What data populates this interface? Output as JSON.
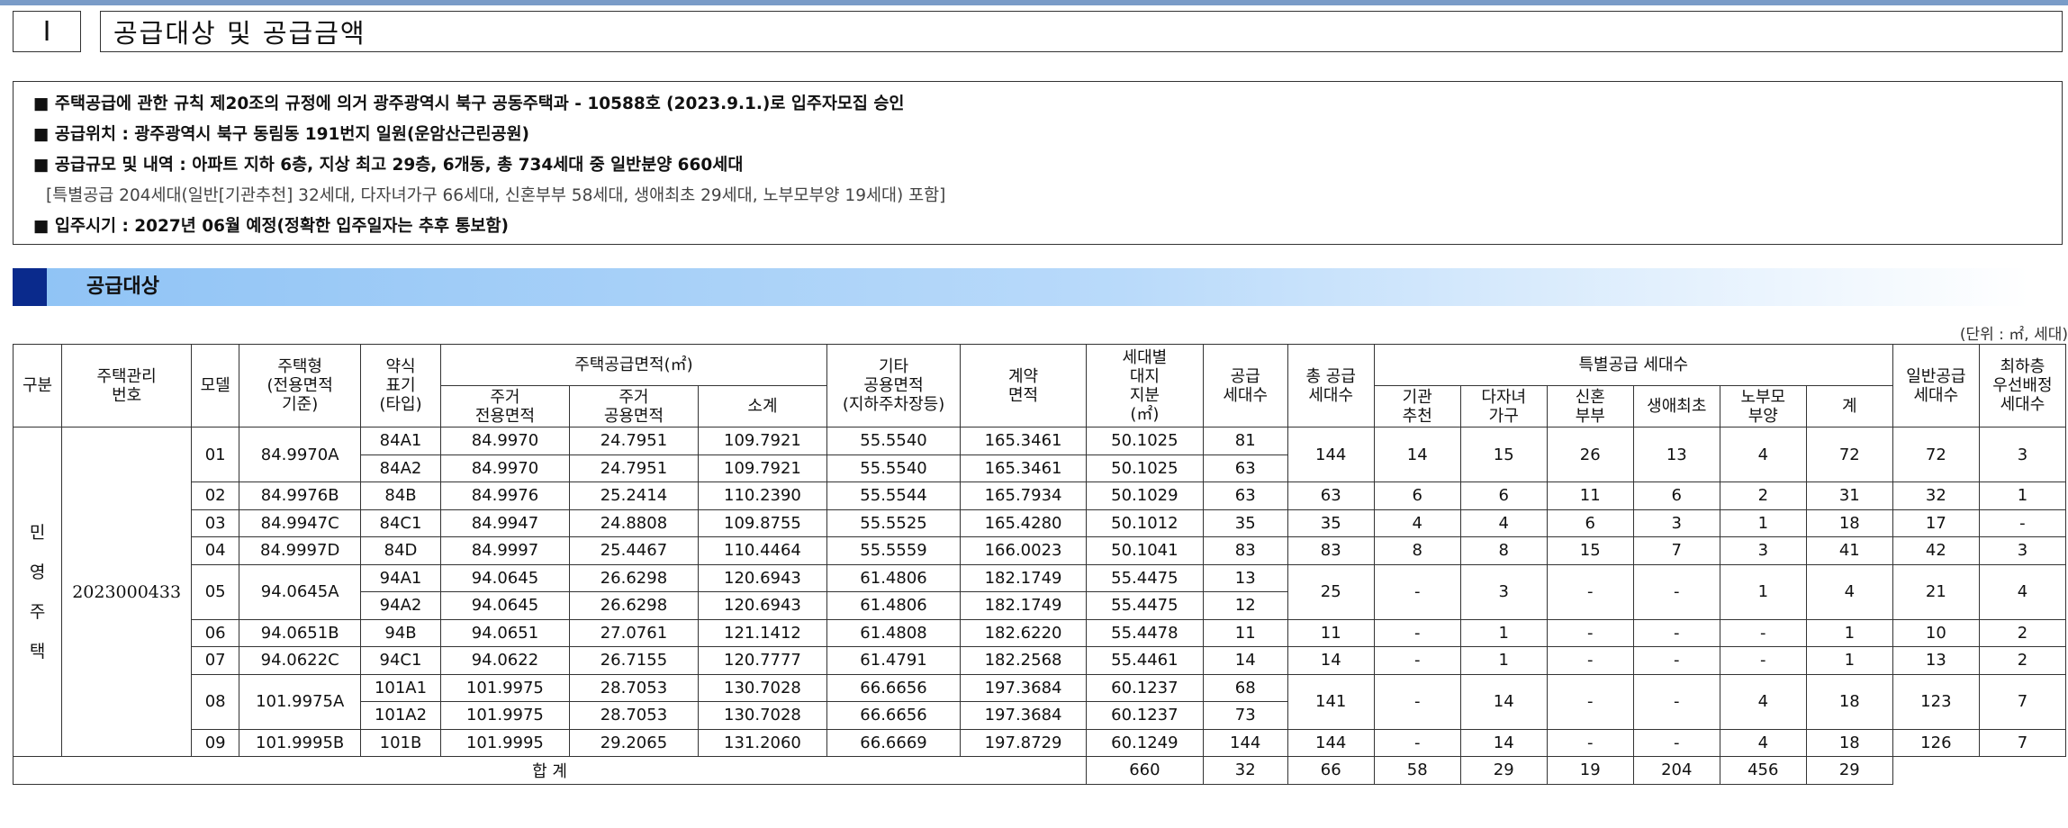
{
  "section": {
    "number": "Ⅰ",
    "title": "공급대상 및 공급금액"
  },
  "notice": {
    "line1": "■ 주택공급에 관한 규칙 제20조의 규정에 의거 광주광역시 북구 공동주택과 - 10588호 (2023.9.1.)로 입주자모집 승인",
    "line2": "■ 공급위치 : 광주광역시 북구 동림동 191번지 일원(운암산근린공원)",
    "line3": "■ 공급규모 및 내역 : 아파트 지하 6층, 지상 최고 29층, 6개동, 총 734세대 중 일반분양 660세대",
    "line4": "[특별공급 204세대(일반[기관추천] 32세대, 다자녀가구 66세대, 신혼부부 58세대, 생애최초 29세대, 노부모부양 19세대) 포함]",
    "line5": "■ 입주시기 : 2027년 06월 예정(정확한 입주일자는 추후 통보함)"
  },
  "subsection": {
    "title": "공급대상"
  },
  "unit_note": "(단위 : ㎡, 세대)",
  "table": {
    "headers": {
      "gubun": "구분",
      "mgmt_no": "주택관리\n번호",
      "model": "모델",
      "housing_type": "주택형\n(전용면적\n기준)",
      "abbr": "약식\n표기\n(타입)",
      "supply_area_group": "주택공급면적(㎡)",
      "excl_area": "주거\n전용면적",
      "common_area": "주거\n공용면적",
      "subtotal": "소계",
      "other_common": "기타\n공용면적\n(지하주차장등)",
      "contract_area": "계약\n면적",
      "land_share": "세대별\n대지\n지분\n(㎡)",
      "supply_units": "공급\n세대수",
      "total_supply": "총 공급\n세대수",
      "special_group": "특별공급 세대수",
      "institution": "기관\n추천",
      "multi_child": "다자녀\n가구",
      "newlywed": "신혼\n부부",
      "first_life": "생애최초",
      "elderly": "노부모\n부양",
      "special_total": "계",
      "general": "일반공급\n세대수",
      "top_floor": "최하층\n우선배정\n세대수"
    },
    "category": "민\n영\n주\n택",
    "mgmt_number": "2023000433",
    "groups": [
      {
        "model": "01",
        "type": "84.9970A",
        "total": "144",
        "inst": "14",
        "multi": "15",
        "newly": "26",
        "first": "13",
        "elder": "4",
        "sp_total": "72",
        "general": "72",
        "low": "3",
        "rows": [
          {
            "abbr": "84A1",
            "excl": "84.9970",
            "common": "24.7951",
            "sub": "109.7921",
            "other": "55.5540",
            "contract": "165.3461",
            "land": "50.1025",
            "units": "81"
          },
          {
            "abbr": "84A2",
            "excl": "84.9970",
            "common": "24.7951",
            "sub": "109.7921",
            "other": "55.5540",
            "contract": "165.3461",
            "land": "50.1025",
            "units": "63"
          }
        ]
      },
      {
        "model": "02",
        "type": "84.9976B",
        "total": "63",
        "inst": "6",
        "multi": "6",
        "newly": "11",
        "first": "6",
        "elder": "2",
        "sp_total": "31",
        "general": "32",
        "low": "1",
        "rows": [
          {
            "abbr": "84B",
            "excl": "84.9976",
            "common": "25.2414",
            "sub": "110.2390",
            "other": "55.5544",
            "contract": "165.7934",
            "land": "50.1029",
            "units": "63"
          }
        ]
      },
      {
        "model": "03",
        "type": "84.9947C",
        "total": "35",
        "inst": "4",
        "multi": "4",
        "newly": "6",
        "first": "3",
        "elder": "1",
        "sp_total": "18",
        "general": "17",
        "low": "-",
        "rows": [
          {
            "abbr": "84C1",
            "excl": "84.9947",
            "common": "24.8808",
            "sub": "109.8755",
            "other": "55.5525",
            "contract": "165.4280",
            "land": "50.1012",
            "units": "35"
          }
        ]
      },
      {
        "model": "04",
        "type": "84.9997D",
        "total": "83",
        "inst": "8",
        "multi": "8",
        "newly": "15",
        "first": "7",
        "elder": "3",
        "sp_total": "41",
        "general": "42",
        "low": "3",
        "rows": [
          {
            "abbr": "84D",
            "excl": "84.9997",
            "common": "25.4467",
            "sub": "110.4464",
            "other": "55.5559",
            "contract": "166.0023",
            "land": "50.1041",
            "units": "83"
          }
        ]
      },
      {
        "model": "05",
        "type": "94.0645A",
        "total": "25",
        "inst": "-",
        "multi": "3",
        "newly": "-",
        "first": "-",
        "elder": "1",
        "sp_total": "4",
        "general": "21",
        "low": "4",
        "rows": [
          {
            "abbr": "94A1",
            "excl": "94.0645",
            "common": "26.6298",
            "sub": "120.6943",
            "other": "61.4806",
            "contract": "182.1749",
            "land": "55.4475",
            "units": "13"
          },
          {
            "abbr": "94A2",
            "excl": "94.0645",
            "common": "26.6298",
            "sub": "120.6943",
            "other": "61.4806",
            "contract": "182.1749",
            "land": "55.4475",
            "units": "12"
          }
        ]
      },
      {
        "model": "06",
        "type": "94.0651B",
        "total": "11",
        "inst": "-",
        "multi": "1",
        "newly": "-",
        "first": "-",
        "elder": "-",
        "sp_total": "1",
        "general": "10",
        "low": "2",
        "rows": [
          {
            "abbr": "94B",
            "excl": "94.0651",
            "common": "27.0761",
            "sub": "121.1412",
            "other": "61.4808",
            "contract": "182.6220",
            "land": "55.4478",
            "units": "11"
          }
        ]
      },
      {
        "model": "07",
        "type": "94.0622C",
        "total": "14",
        "inst": "-",
        "multi": "1",
        "newly": "-",
        "first": "-",
        "elder": "-",
        "sp_total": "1",
        "general": "13",
        "low": "2",
        "rows": [
          {
            "abbr": "94C1",
            "excl": "94.0622",
            "common": "26.7155",
            "sub": "120.7777",
            "other": "61.4791",
            "contract": "182.2568",
            "land": "55.4461",
            "units": "14"
          }
        ]
      },
      {
        "model": "08",
        "type": "101.9975A",
        "total": "141",
        "inst": "-",
        "multi": "14",
        "newly": "-",
        "first": "-",
        "elder": "4",
        "sp_total": "18",
        "general": "123",
        "low": "7",
        "rows": [
          {
            "abbr": "101A1",
            "excl": "101.9975",
            "common": "28.7053",
            "sub": "130.7028",
            "other": "66.6656",
            "contract": "197.3684",
            "land": "60.1237",
            "units": "68"
          },
          {
            "abbr": "101A2",
            "excl": "101.9975",
            "common": "28.7053",
            "sub": "130.7028",
            "other": "66.6656",
            "contract": "197.3684",
            "land": "60.1237",
            "units": "73"
          }
        ]
      },
      {
        "model": "09",
        "type": "101.9995B",
        "total": "144",
        "inst": "-",
        "multi": "14",
        "newly": "-",
        "first": "-",
        "elder": "4",
        "sp_total": "18",
        "general": "126",
        "low": "7",
        "rows": [
          {
            "abbr": "101B",
            "excl": "101.9995",
            "common": "29.2065",
            "sub": "131.2060",
            "other": "66.6669",
            "contract": "197.8729",
            "land": "60.1249",
            "units": "144"
          }
        ]
      }
    ],
    "totals": {
      "label": "합    계",
      "total": "660",
      "inst": "32",
      "multi": "66",
      "newly": "58",
      "first": "29",
      "elder": "19",
      "sp_total": "204",
      "general": "456",
      "low": "29"
    }
  }
}
